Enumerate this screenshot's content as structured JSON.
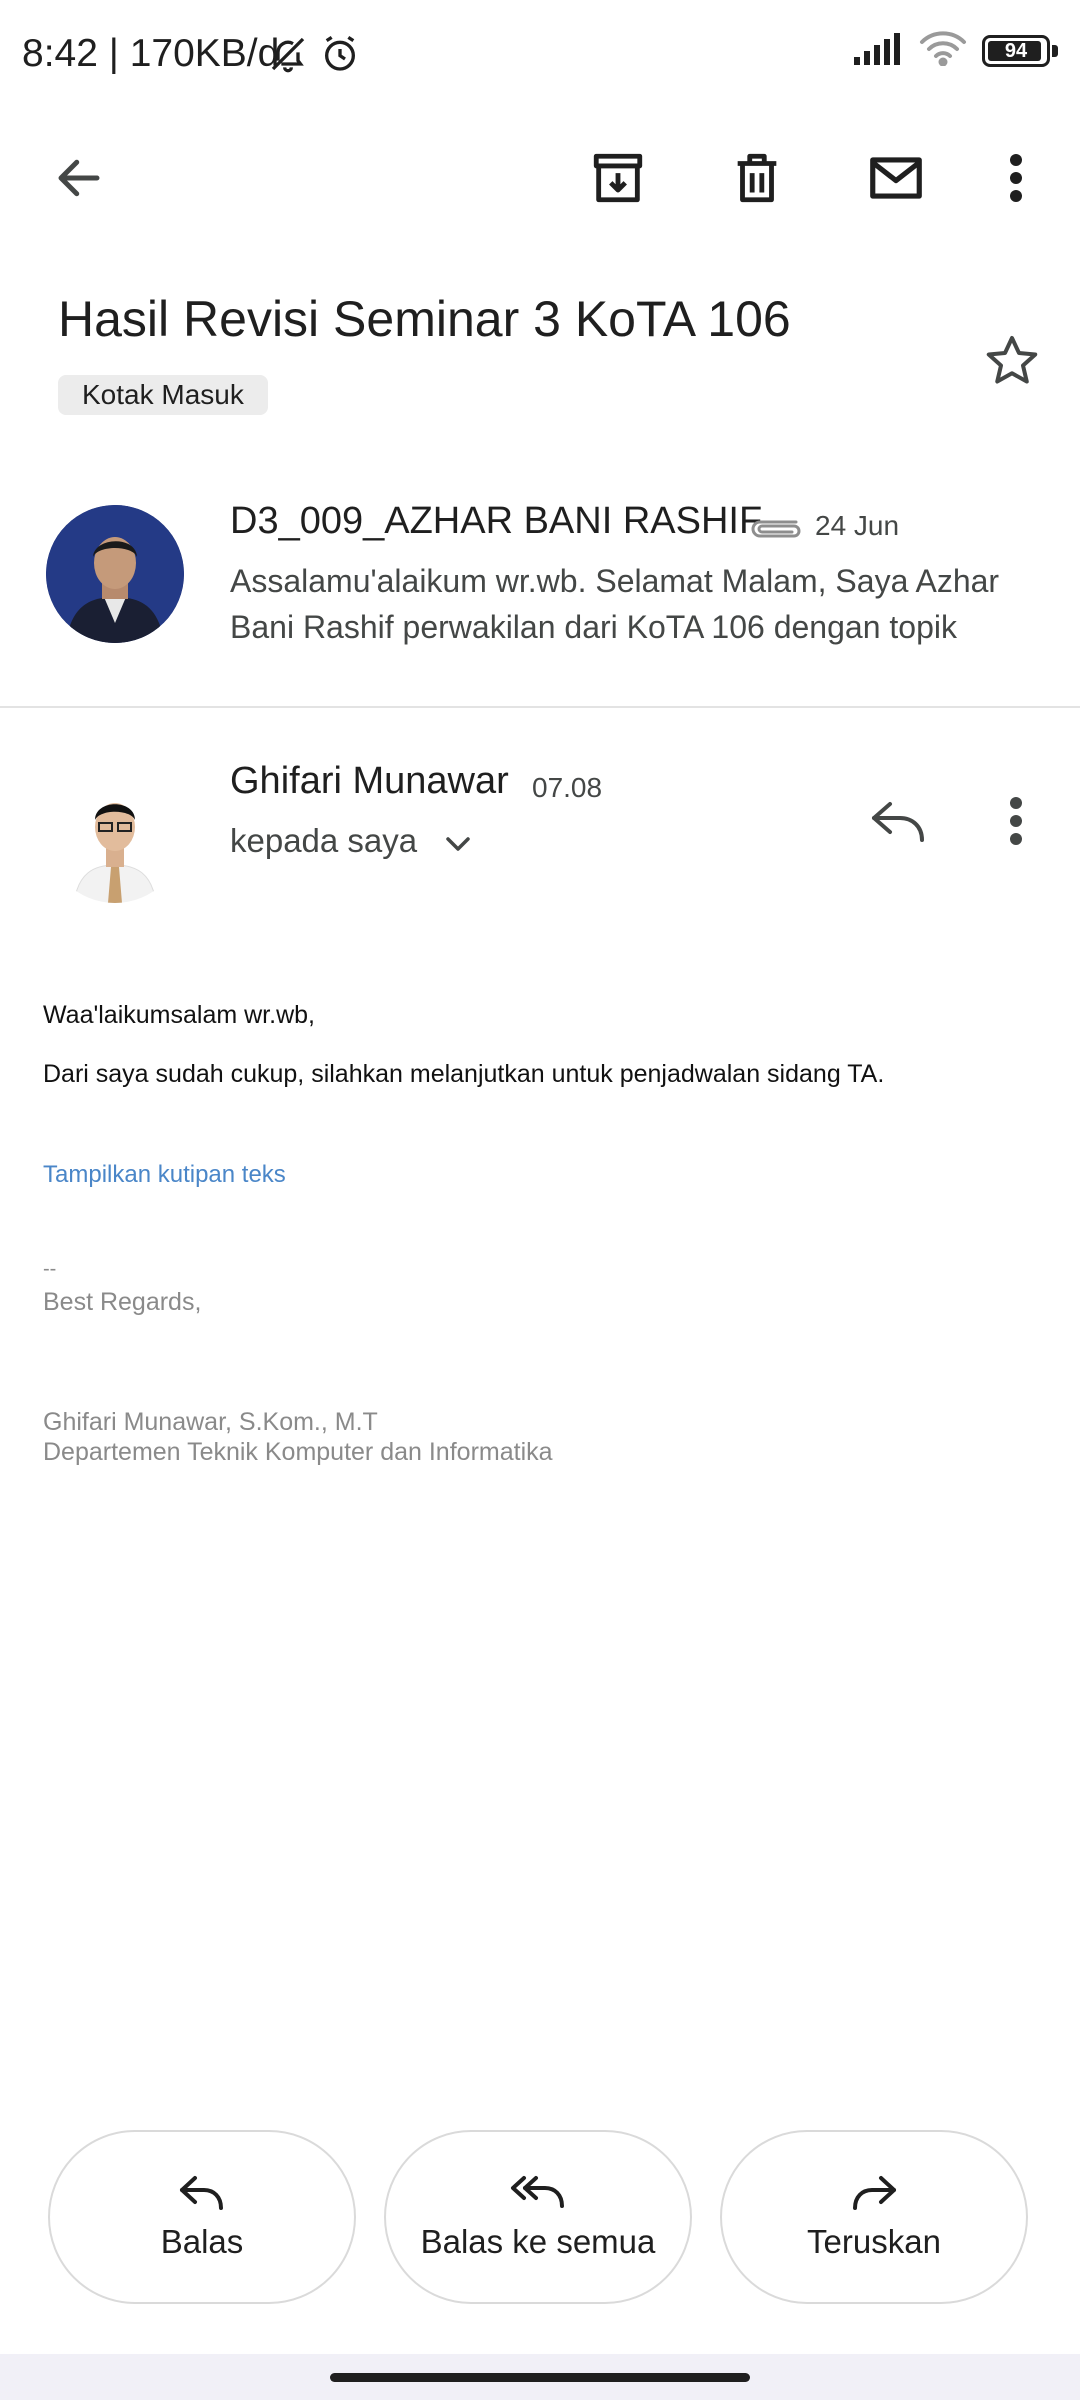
{
  "status_bar": {
    "time_speed": "8:42 | 170KB/d",
    "battery": "94",
    "battery_level": 0.94,
    "icons": [
      "bell-off-icon",
      "alarm-icon",
      "signal-icon",
      "wifi-icon",
      "battery-icon"
    ]
  },
  "app_bar": {
    "icons": [
      "back-arrow-icon",
      "archive-icon",
      "delete-icon",
      "mark-unread-icon",
      "more-vert-icon"
    ]
  },
  "email": {
    "subject": "Hasil Revisi Seminar 3 KoTA 106",
    "label": "Kotak Masuk"
  },
  "thread": [
    {
      "sender": "D3_009_AZHAR BANI RASHIF",
      "date": "24 Jun",
      "snippet": "Assalamu'alaikum wr.wb. Selamat Malam, Saya Azhar Bani Rashif perwakilan dari KoTA 106 dengan topik"
    },
    {
      "sender": "Ghifari Munawar",
      "time": "07.08",
      "recipient": "kepada saya"
    }
  ],
  "body": {
    "greeting": "Waa'laikumsalam wr.wb,",
    "line1": "Dari saya sudah cukup, silahkan melanjutkan untuk penjadwalan sidang TA.",
    "quote_link": "Tampilkan kutipan teks",
    "sig_dash": "--",
    "sig_regards": "Best Regards,",
    "sig_name": "Ghifari Munawar, S.Kom., M.T",
    "sig_dept": "Departemen Teknik Komputer dan Informatika"
  },
  "actions": {
    "reply": "Balas",
    "reply_all": "Balas ke semua",
    "forward": "Teruskan"
  },
  "colors": {
    "accent_link": "#4a86c8",
    "avatar1_bg": "#1f2f6e"
  }
}
